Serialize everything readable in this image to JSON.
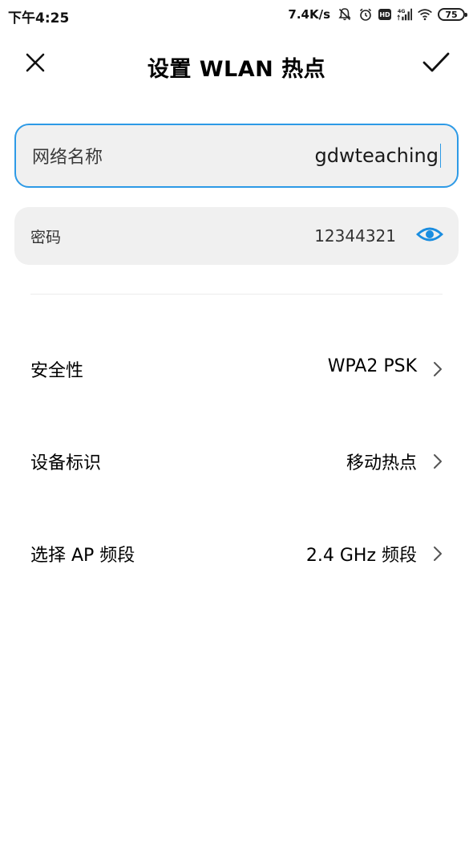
{
  "status_bar": {
    "time": "下午4:25",
    "net_speed": "7.4K/s",
    "hd_badge": "HD",
    "battery": "75",
    "icons": [
      "mute-icon",
      "alarm-icon",
      "hd-icon",
      "cellular-signal-icon",
      "wifi-icon",
      "battery-icon"
    ]
  },
  "header": {
    "title": "设置 WLAN 热点",
    "close_icon": "close-icon",
    "confirm_icon": "check-icon"
  },
  "fields": {
    "ssid": {
      "label": "网络名称",
      "value": "gdwteaching"
    },
    "password": {
      "label": "密码",
      "value": "12344321",
      "toggle_icon": "eye-icon"
    }
  },
  "settings": [
    {
      "label": "安全性",
      "value": "WPA2 PSK"
    },
    {
      "label": "设备标识",
      "value": "移动热点"
    },
    {
      "label": "选择 AP 频段",
      "value": "2.4 GHz 频段"
    }
  ],
  "colors": {
    "accent": "#2d9ae6",
    "field_bg": "#f0f0f0",
    "text": "#000000"
  }
}
